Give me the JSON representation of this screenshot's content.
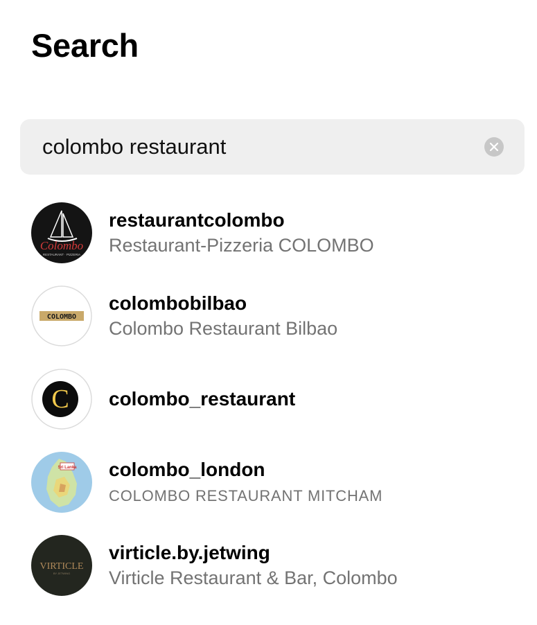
{
  "page": {
    "title": "Search"
  },
  "search": {
    "value": "colombo restaurant",
    "clear_label": "×"
  },
  "results": [
    {
      "username": "restaurantcolombo",
      "fullname": "Restaurant-Pizzeria COLOMBO",
      "avatar_icon": "colombo-pizzeria-logo-icon",
      "avatar_text": "Colombo",
      "avatar_subtext": "RESTAURANT · PIZZERIA"
    },
    {
      "username": "colombobilbao",
      "fullname": "Colombo Restaurant Bilbao",
      "avatar_icon": "colombo-bilbao-logo-icon",
      "avatar_text": "COLOMBO"
    },
    {
      "username": "colombo_restaurant",
      "fullname": "",
      "avatar_icon": "letter-c-logo-icon",
      "avatar_text": "C"
    },
    {
      "username": "colombo_london",
      "fullname": "COLOMBO RESTAURANT MITCHAM",
      "avatar_icon": "sri-lanka-map-icon",
      "avatar_text": "Sri Lanka"
    },
    {
      "username": "virticle.by.jetwing",
      "fullname": "Virticle Restaurant & Bar, Colombo",
      "avatar_icon": "virticle-logo-icon",
      "avatar_text": "VIRTICLE",
      "avatar_subtext": "BY JETWING"
    }
  ],
  "colors": {
    "background": "#ffffff",
    "search_bg": "#efefef",
    "secondary_text": "#737373",
    "clear_button": "#c7c7c7"
  }
}
